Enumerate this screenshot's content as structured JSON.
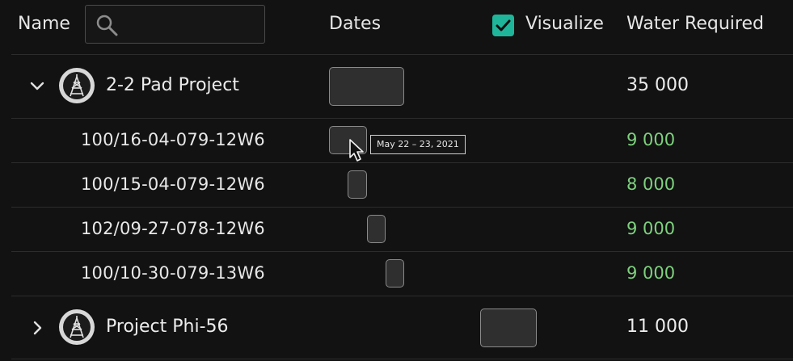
{
  "header": {
    "name_label": "Name",
    "search_placeholder": "",
    "dates_label": "Dates",
    "visualize_label": "Visualize",
    "visualize_checked": true,
    "water_label": "Water Required"
  },
  "projects": [
    {
      "name": "2-2 Pad Project",
      "expanded": true,
      "water": "35 000",
      "icon": "drilling-rig-icon",
      "wells": [
        {
          "name": "100/16-04-079-12W6",
          "water": "9 000"
        },
        {
          "name": "100/15-04-079-12W6",
          "water": "8 000"
        },
        {
          "name": "102/09-27-078-12W6",
          "water": "9 000"
        },
        {
          "name": "100/10-30-079-13W6",
          "water": "9 000"
        }
      ]
    },
    {
      "name": "Project Phi-56",
      "expanded": false,
      "water": "11 000",
      "icon": "drilling-rig-icon"
    }
  ],
  "tooltip": {
    "text": "May 22 – 23, 2021"
  },
  "colors": {
    "accent": "#1fb59a",
    "water_child": "#7ed17e",
    "background": "#121212"
  }
}
